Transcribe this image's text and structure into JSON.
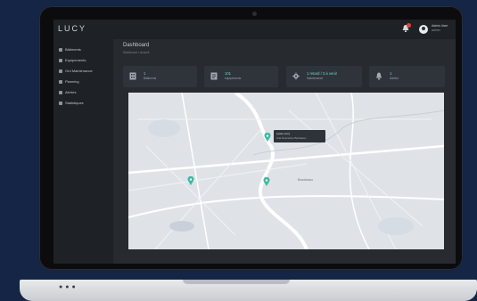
{
  "app": {
    "logo": "LUCY"
  },
  "user": {
    "name": "Admin User",
    "role": "admin"
  },
  "sidebar": {
    "items": [
      {
        "label": "Bâtiments"
      },
      {
        "label": "Equipements"
      },
      {
        "label": "Ord Maintenance"
      },
      {
        "label": "Planning"
      },
      {
        "label": "Alertes"
      },
      {
        "label": "Statistiques"
      }
    ]
  },
  "main": {
    "title": "Dashboard",
    "breadcrumb": "Dashboard > Accueil"
  },
  "stats": [
    {
      "value": "1",
      "label": "Bâtiments",
      "icon": "building-icon"
    },
    {
      "value": "101",
      "label": "équipements",
      "icon": "document-icon"
    },
    {
      "value": "1 retard / 3 à venir",
      "label": "Maintenance",
      "icon": "gear-icon"
    },
    {
      "value": "1",
      "label": "Alertes",
      "icon": "bell-icon"
    }
  ],
  "map": {
    "popup": {
      "title": "Lycée Lucy",
      "subtitle": "Cité Descartes Bordeaux"
    },
    "city_label": "Bordeaux",
    "pin_color": "#3fb8a6"
  },
  "colors": {
    "accent": "#6fd4c8",
    "notification": "#e2453b"
  }
}
